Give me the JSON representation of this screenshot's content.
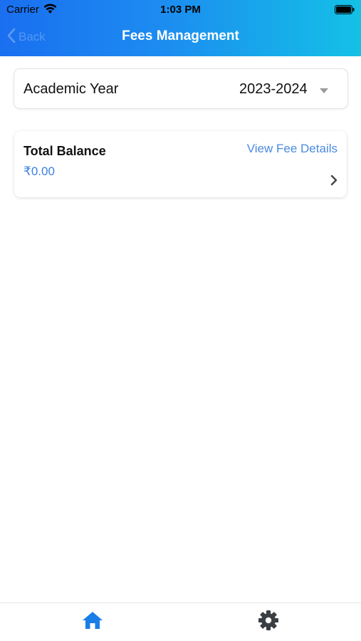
{
  "status_bar": {
    "carrier": "Carrier",
    "time": "1:03 PM",
    "icons": [
      "wifi-icon",
      "battery-icon"
    ]
  },
  "nav": {
    "back_label": "Back",
    "title": "Fees Management",
    "back_icon": "chevron-left-icon"
  },
  "academic_year": {
    "label": "Academic Year",
    "selected": "2023-2024",
    "dropdown_icon": "caret-down-icon"
  },
  "balance": {
    "title": "Total Balance",
    "amount": "₹0.00",
    "link_label": "View Fee Details",
    "chevron_icon": "chevron-right-icon"
  },
  "tab_bar": {
    "items": [
      {
        "icon": "home-icon",
        "active": true
      },
      {
        "icon": "gear-icon",
        "active": false
      }
    ]
  },
  "colors": {
    "header_gradient_start": "#1a6ff0",
    "header_gradient_end": "#14c1e6",
    "accent_blue": "#3b7fe3",
    "tab_active": "#1a7de8",
    "tab_inactive": "#3a3f44"
  }
}
